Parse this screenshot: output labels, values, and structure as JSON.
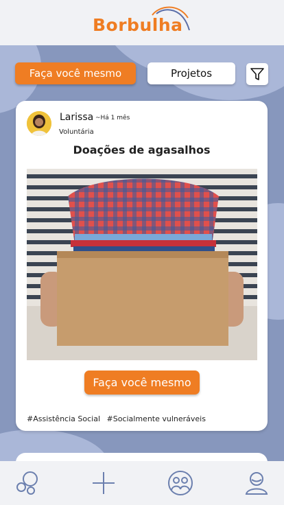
{
  "app": {
    "brand": "Borbulha",
    "brand_color": "#ef7d23",
    "accent_blue": "#8797bd"
  },
  "filters": {
    "active_label": "Faça você mesmo",
    "secondary_label": "Projetos",
    "filter_icon": "funnel-icon"
  },
  "post": {
    "author": "Larissa",
    "time": "~Há 1 mês",
    "role": "Voluntária",
    "title": "Doações de agasalhos",
    "image_desc": "box-of-folded-shirts",
    "cta_label": "Faça você mesmo",
    "tags": [
      "#Assistência Social",
      "#Socialmente vulneráveis"
    ]
  },
  "nav": {
    "items": [
      "bubbles-icon",
      "plus-icon",
      "community-icon",
      "profile-icon"
    ]
  }
}
